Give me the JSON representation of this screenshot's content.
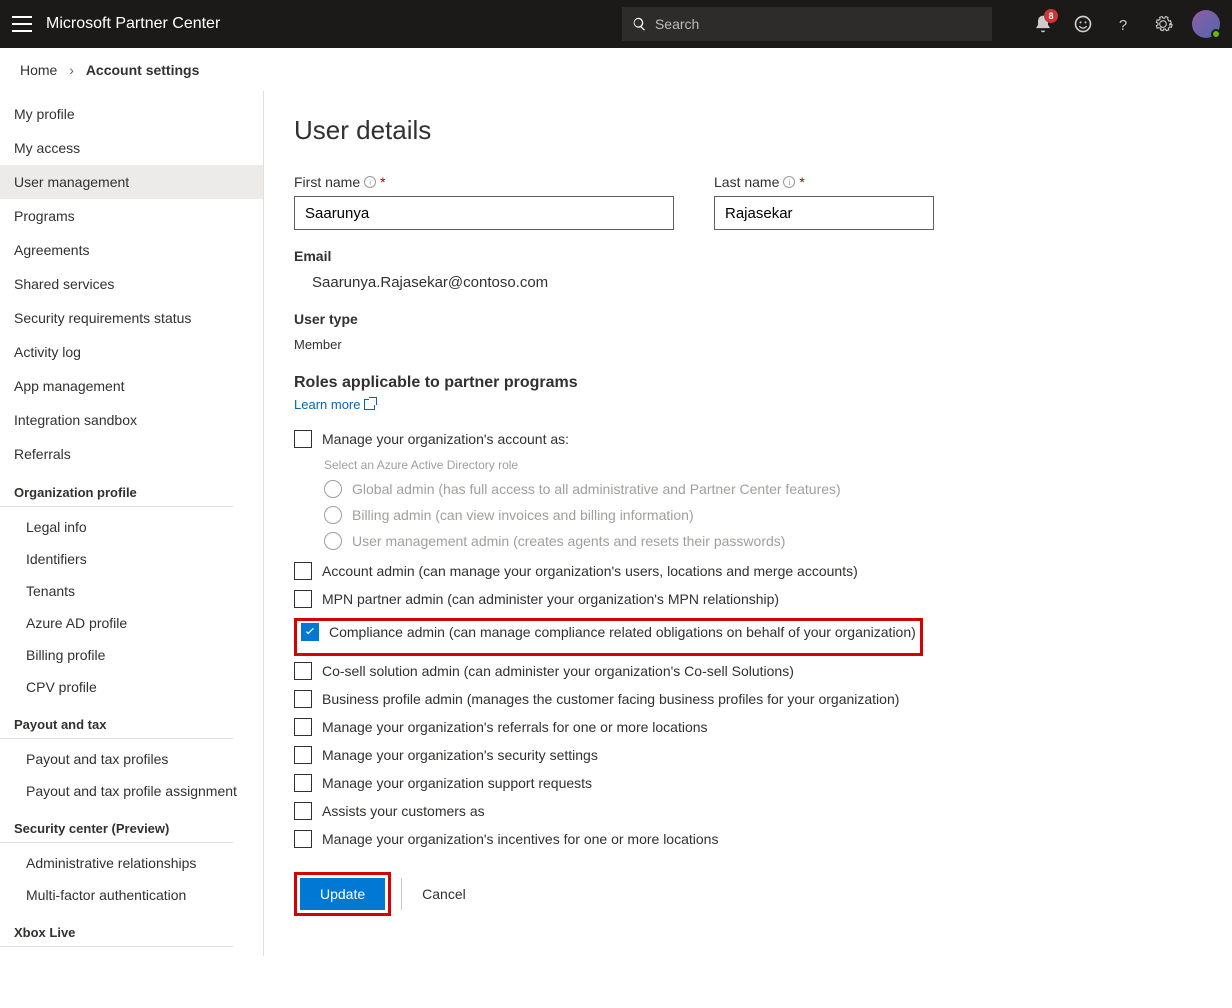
{
  "header": {
    "brand": "Microsoft Partner Center",
    "search_placeholder": "Search",
    "notification_count": "8"
  },
  "breadcrumb": {
    "home": "Home",
    "current": "Account settings"
  },
  "sidebar": {
    "items": [
      "My profile",
      "My access",
      "User management",
      "Programs",
      "Agreements",
      "Shared services",
      "Security requirements status",
      "Activity log",
      "App management",
      "Integration sandbox",
      "Referrals"
    ],
    "active_index": 2,
    "groups": [
      {
        "heading": "Organization profile",
        "items": [
          "Legal info",
          "Identifiers",
          "Tenants",
          "Azure AD profile",
          "Billing profile",
          "CPV profile"
        ]
      },
      {
        "heading": "Payout and tax",
        "items": [
          "Payout and tax profiles",
          "Payout and tax profile assignment"
        ]
      },
      {
        "heading": "Security center (Preview)",
        "items": [
          "Administrative relationships",
          "Multi-factor authentication"
        ]
      },
      {
        "heading": "Xbox Live",
        "items": []
      }
    ]
  },
  "page": {
    "title": "User details",
    "first_name_label": "First name",
    "last_name_label": "Last name",
    "first_name": "Saarunya",
    "last_name": "Rajasekar",
    "email_label": "Email",
    "email": "Saarunya.Rajasekar@contoso.com",
    "user_type_label": "User type",
    "user_type": "Member",
    "roles_heading": "Roles applicable to partner programs",
    "learn_more": "Learn more",
    "manage_as_label": "Manage your organization's account as:",
    "azure_hint": "Select an Azure Active Directory role",
    "azure_roles": [
      "Global admin (has full access to all administrative and Partner Center features)",
      "Billing admin (can view invoices and billing information)",
      "User management admin (creates agents and resets their passwords)"
    ],
    "role_checkboxes": [
      {
        "label": "Account admin (can manage your organization's users, locations and merge accounts)",
        "checked": false
      },
      {
        "label": "MPN partner admin (can administer your organization's MPN relationship)",
        "checked": false
      },
      {
        "label": "Compliance admin (can manage compliance related obligations on behalf of your organization)",
        "checked": true,
        "highlighted": true
      },
      {
        "label": "Co-sell solution admin (can administer your organization's Co-sell Solutions)",
        "checked": false
      },
      {
        "label": "Business profile admin (manages the customer facing business profiles for your organization)",
        "checked": false
      },
      {
        "label": "Manage your organization's referrals for one or more locations",
        "checked": false
      },
      {
        "label": "Manage your organization's security settings",
        "checked": false
      },
      {
        "label": "Manage your organization support requests",
        "checked": false
      },
      {
        "label": "Assists your customers as",
        "checked": false
      },
      {
        "label": "Manage your organization's incentives for one or more locations",
        "checked": false
      }
    ],
    "update_btn": "Update",
    "cancel_btn": "Cancel"
  }
}
